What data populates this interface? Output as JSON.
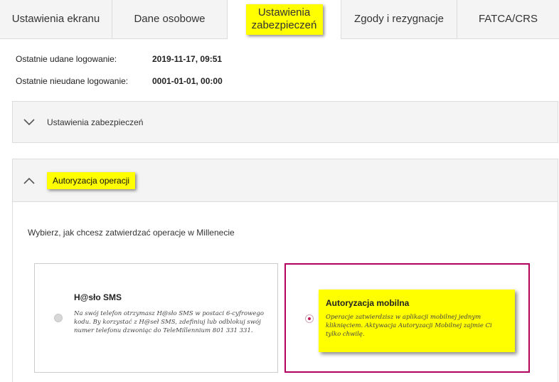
{
  "tabs": [
    {
      "label": "Ustawienia ekranu"
    },
    {
      "label": "Dane osobowe"
    },
    {
      "label": "Ustawienia zabezpieczeń"
    },
    {
      "label": "Zgody i rezygnacje"
    },
    {
      "label": "FATCA/CRS"
    }
  ],
  "login_info": {
    "last_success_label": "Ostatnie udane logowanie:",
    "last_success_value": "2019-11-17, 09:51",
    "last_failed_label": "Ostatnie nieudane logowanie:",
    "last_failed_value": "0001-01-01, 00:00"
  },
  "sections": {
    "security_settings": {
      "title": "Ustawienia zabezpieczeń"
    },
    "operation_authorization": {
      "title": "Autoryzacja operacji",
      "intro": "Wybierz, jak chcesz zatwierdzać operacje w Millenecie",
      "options": [
        {
          "title": "H@sło SMS",
          "description": "Na swój telefon otrzymasz H@sło SMS w postaci 6-cyfrowego kodu. By korzystać z H@seł SMS, zdefiniuj lub odblokuj swój numer telefonu dzwoniąc do TeleMillennium 801 331 331."
        },
        {
          "title": "Autoryzacja mobilna",
          "description": "Operacje zatwierdzisz w aplikacji mobilnej jednym kliknięciem. Aktywacja Autoryzacji Mobilnej zajmie Ci tylko chwilę."
        }
      ]
    }
  },
  "colors": {
    "highlight": "#ffff00",
    "selected_border": "#b3005e",
    "radio_selected": "#c2185b"
  }
}
